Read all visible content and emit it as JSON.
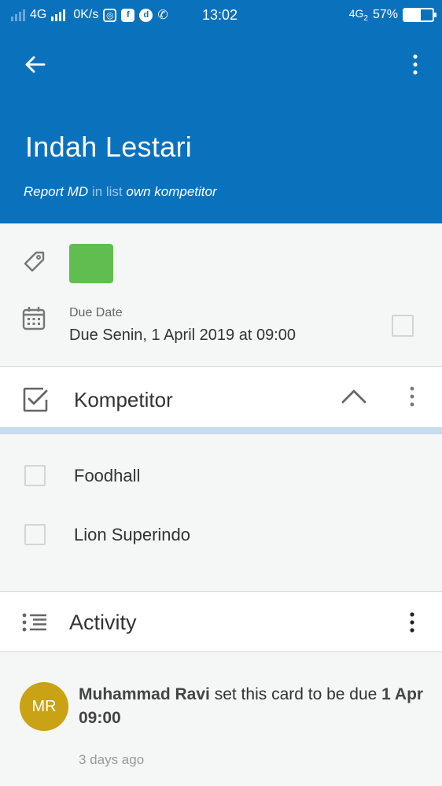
{
  "status_bar": {
    "network": "4G",
    "speed": "0K/s",
    "time": "13:02",
    "network_right": "4G",
    "network_right_sub": "2",
    "battery_percent": "57%",
    "battery_level": 0.57
  },
  "header": {
    "title": "Indah Lestari",
    "board": "Report MD",
    "in_list_text": " in list ",
    "list": "own kompetitor",
    "background_color": "#0a72bd"
  },
  "labels": {
    "chip_color": "#61bd4f"
  },
  "due": {
    "label": "Due Date",
    "value": "Due Senin, 1 April 2019 at 09:00"
  },
  "checklist": {
    "title": "Kompetitor",
    "items": [
      {
        "text": "Foodhall",
        "checked": false
      },
      {
        "text": "Lion Superindo",
        "checked": false
      }
    ]
  },
  "activity": {
    "title": "Activity",
    "entries": [
      {
        "avatar_initials": "MR",
        "avatar_color": "#c9a215",
        "user": "Muhammad Ravi",
        "action": " set this card to be due ",
        "due_part1": "1 Apr",
        "due_part2": "09:00",
        "time": "3 days ago"
      }
    ]
  }
}
